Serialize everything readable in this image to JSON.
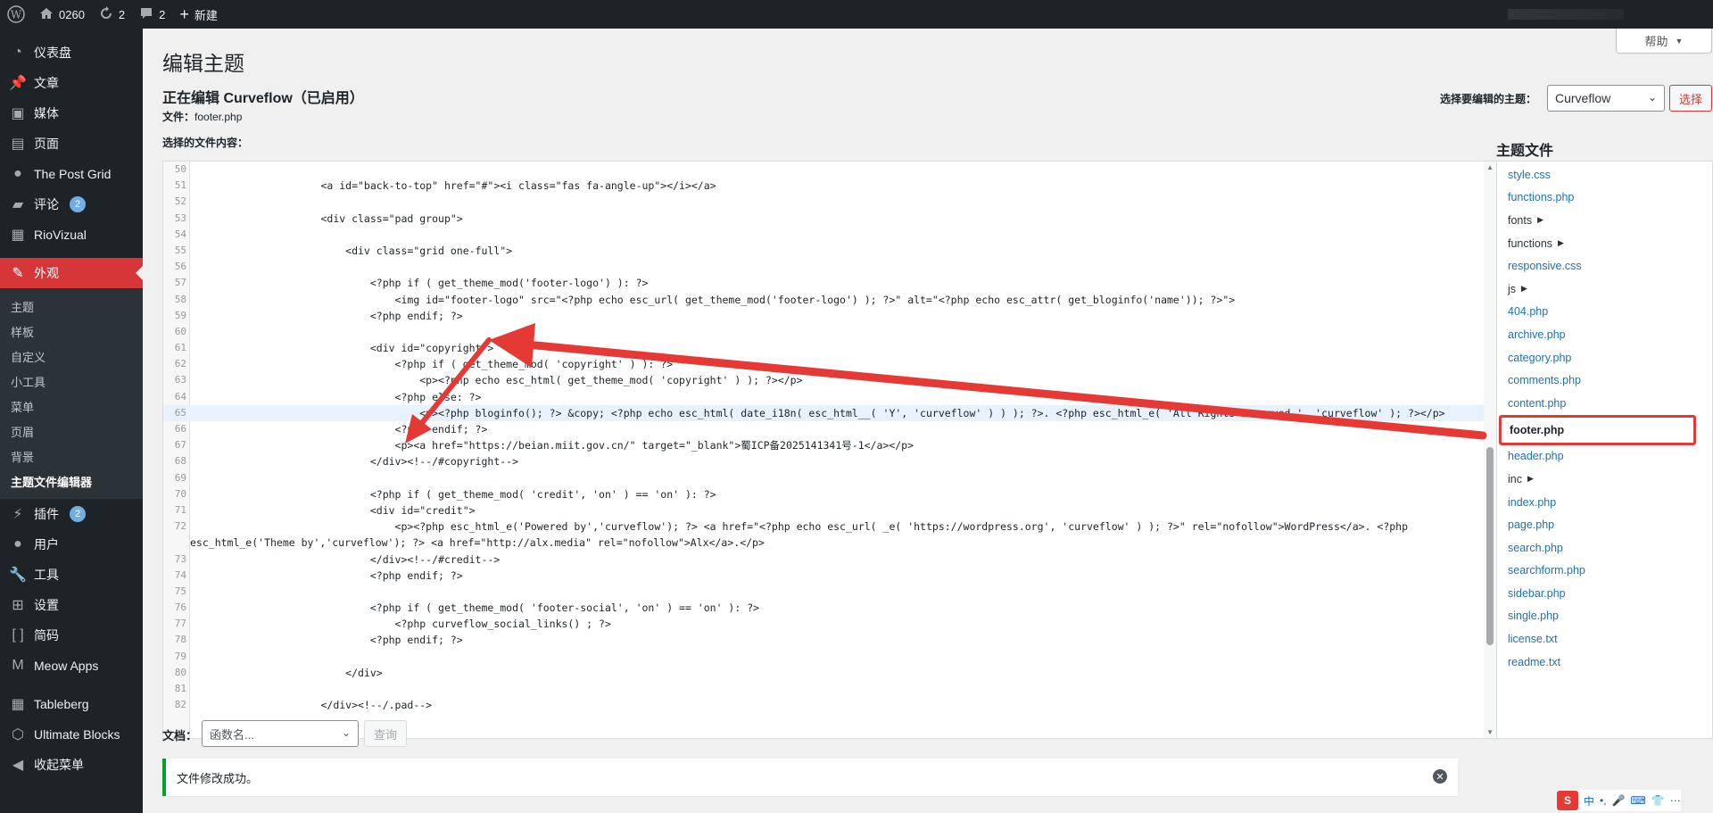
{
  "adminbar": {
    "site_name": "0260",
    "updates_count": "2",
    "comments_count": "2",
    "new_label": "新建"
  },
  "sidebar": {
    "items": [
      {
        "label": "仪表盘",
        "icon": "dashboard-icon"
      },
      {
        "label": "文章",
        "icon": "pin-icon"
      },
      {
        "label": "媒体",
        "icon": "media-icon"
      },
      {
        "label": "页面",
        "icon": "page-icon"
      },
      {
        "label": "The Post Grid",
        "icon": "post-grid-icon"
      },
      {
        "label": "评论",
        "icon": "comment-icon",
        "badge": "2"
      },
      {
        "label": "RioVizual",
        "icon": "riovizual-icon"
      },
      {
        "label": "外观",
        "icon": "brush-icon",
        "active": true
      },
      {
        "label": "插件",
        "icon": "plugin-icon",
        "badge": "2"
      },
      {
        "label": "用户",
        "icon": "user-icon"
      },
      {
        "label": "工具",
        "icon": "wrench-icon"
      },
      {
        "label": "设置",
        "icon": "settings-icon"
      },
      {
        "label": "简码",
        "icon": "shortcode-icon"
      },
      {
        "label": "Meow Apps",
        "icon": "meow-icon"
      },
      {
        "label": "Tableberg",
        "icon": "table-icon"
      },
      {
        "label": "Ultimate Blocks",
        "icon": "blocks-icon"
      },
      {
        "label": "收起菜单",
        "icon": "collapse-icon"
      }
    ],
    "submenu": [
      "主题",
      "样板",
      "自定义",
      "小工具",
      "菜单",
      "页眉",
      "背景",
      "主题文件编辑器"
    ]
  },
  "main": {
    "page_title": "编辑主题",
    "help_label": "帮助",
    "editing_title": "正在编辑 Curveflow（已启用）",
    "file_label": "文件：",
    "file_name": "footer.php",
    "select_theme_label": "选择要编辑的主题：",
    "theme_value": "Curveflow",
    "select_button": "选择",
    "content_label": "选择的文件内容："
  },
  "code": {
    "lines": [
      {
        "n": "50",
        "t": ""
      },
      {
        "n": "51",
        "t": "                    <a id=\"back-to-top\" href=\"#\"><i class=\"fas fa-angle-up\"></i></a>"
      },
      {
        "n": "52",
        "t": ""
      },
      {
        "n": "53",
        "t": "                    <div class=\"pad group\">"
      },
      {
        "n": "54",
        "t": ""
      },
      {
        "n": "55",
        "t": "                        <div class=\"grid one-full\">"
      },
      {
        "n": "56",
        "t": ""
      },
      {
        "n": "57",
        "t": "                            <?php if ( get_theme_mod('footer-logo') ): ?>"
      },
      {
        "n": "58",
        "t": "                                <img id=\"footer-logo\" src=\"<?php echo esc_url( get_theme_mod('footer-logo') ); ?>\" alt=\"<?php echo esc_attr( get_bloginfo('name')); ?>\">"
      },
      {
        "n": "59",
        "t": "                            <?php endif; ?>"
      },
      {
        "n": "60",
        "t": ""
      },
      {
        "n": "61",
        "t": "                            <div id=\"copyright\">"
      },
      {
        "n": "62",
        "t": "                                <?php if ( get_theme_mod( 'copyright' ) ): ?>"
      },
      {
        "n": "63",
        "t": "                                    <p><?php echo esc_html( get_theme_mod( 'copyright' ) ); ?></p>"
      },
      {
        "n": "64",
        "t": "                                <?php else: ?>"
      },
      {
        "n": "65",
        "t": "                                    <p><?php bloginfo(); ?> &copy; <?php echo esc_html( date_i18n( esc_html__( 'Y', 'curveflow' ) ) ); ?>. <?php esc_html_e( 'All Rights Reserved.', 'curveflow' ); ?></p>"
      },
      {
        "n": "66",
        "t": "                                <?php endif; ?>"
      },
      {
        "n": "67",
        "t": "                                <p><a href=\"https://beian.miit.gov.cn/\" target=\"_blank\">蜀ICP备2025141341号-1</a></p>"
      },
      {
        "n": "68",
        "t": "                            </div><!--/#copyright-->"
      },
      {
        "n": "69",
        "t": ""
      },
      {
        "n": "70",
        "t": "                            <?php if ( get_theme_mod( 'credit', 'on' ) == 'on' ): ?>"
      },
      {
        "n": "71",
        "t": "                            <div id=\"credit\">"
      },
      {
        "n": "72",
        "t": "                                <p><?php esc_html_e('Powered by','curveflow'); ?> <a href=\"<?php echo esc_url( _e( 'https://wordpress.org', 'curveflow' ) ); ?>\" rel=\"nofollow\">WordPress</a>. <?php"
      },
      {
        "n": "",
        "t": "esc_html_e('Theme by','curveflow'); ?> <a href=\"http://alx.media\" rel=\"nofollow\">Alx</a>.</p>"
      },
      {
        "n": "73",
        "t": "                            </div><!--/#credit-->"
      },
      {
        "n": "74",
        "t": "                            <?php endif; ?>"
      },
      {
        "n": "75",
        "t": ""
      },
      {
        "n": "76",
        "t": "                            <?php if ( get_theme_mod( 'footer-social', 'on' ) == 'on' ): ?>"
      },
      {
        "n": "77",
        "t": "                                <?php curveflow_social_links() ; ?>"
      },
      {
        "n": "78",
        "t": "                            <?php endif; ?>"
      },
      {
        "n": "79",
        "t": ""
      },
      {
        "n": "80",
        "t": "                        </div>"
      },
      {
        "n": "81",
        "t": ""
      },
      {
        "n": "82",
        "t": "                    </div><!--/.pad-->"
      }
    ]
  },
  "theme_files": {
    "title": "主题文件",
    "files": [
      {
        "name": "style.css"
      },
      {
        "name": "functions.php"
      },
      {
        "name": "fonts",
        "dir": true
      },
      {
        "name": "functions",
        "dir": true
      },
      {
        "name": "responsive.css"
      },
      {
        "name": "js",
        "dir": true
      },
      {
        "name": "404.php"
      },
      {
        "name": "archive.php"
      },
      {
        "name": "category.php"
      },
      {
        "name": "comments.php"
      },
      {
        "name": "content.php"
      },
      {
        "name": "footer.php",
        "current": true
      },
      {
        "name": "header.php"
      },
      {
        "name": "inc",
        "dir": true
      },
      {
        "name": "index.php"
      },
      {
        "name": "page.php"
      },
      {
        "name": "search.php"
      },
      {
        "name": "searchform.php"
      },
      {
        "name": "sidebar.php"
      },
      {
        "name": "single.php"
      },
      {
        "name": "license.txt"
      },
      {
        "name": "readme.txt"
      }
    ]
  },
  "docs": {
    "label": "文档：",
    "placeholder": "函数名...",
    "lookup_button": "查询"
  },
  "notice": {
    "text": "文件修改成功。"
  },
  "ime": {
    "items": [
      "中",
      "•,",
      "🎤",
      "⌨",
      "👕",
      "⋯"
    ]
  },
  "colors": {
    "admin_bg": "#1d2327",
    "accent_red": "#d63638",
    "link_blue": "#2271b1",
    "success_green": "#00a32a",
    "annotation_red": "#e53935"
  }
}
